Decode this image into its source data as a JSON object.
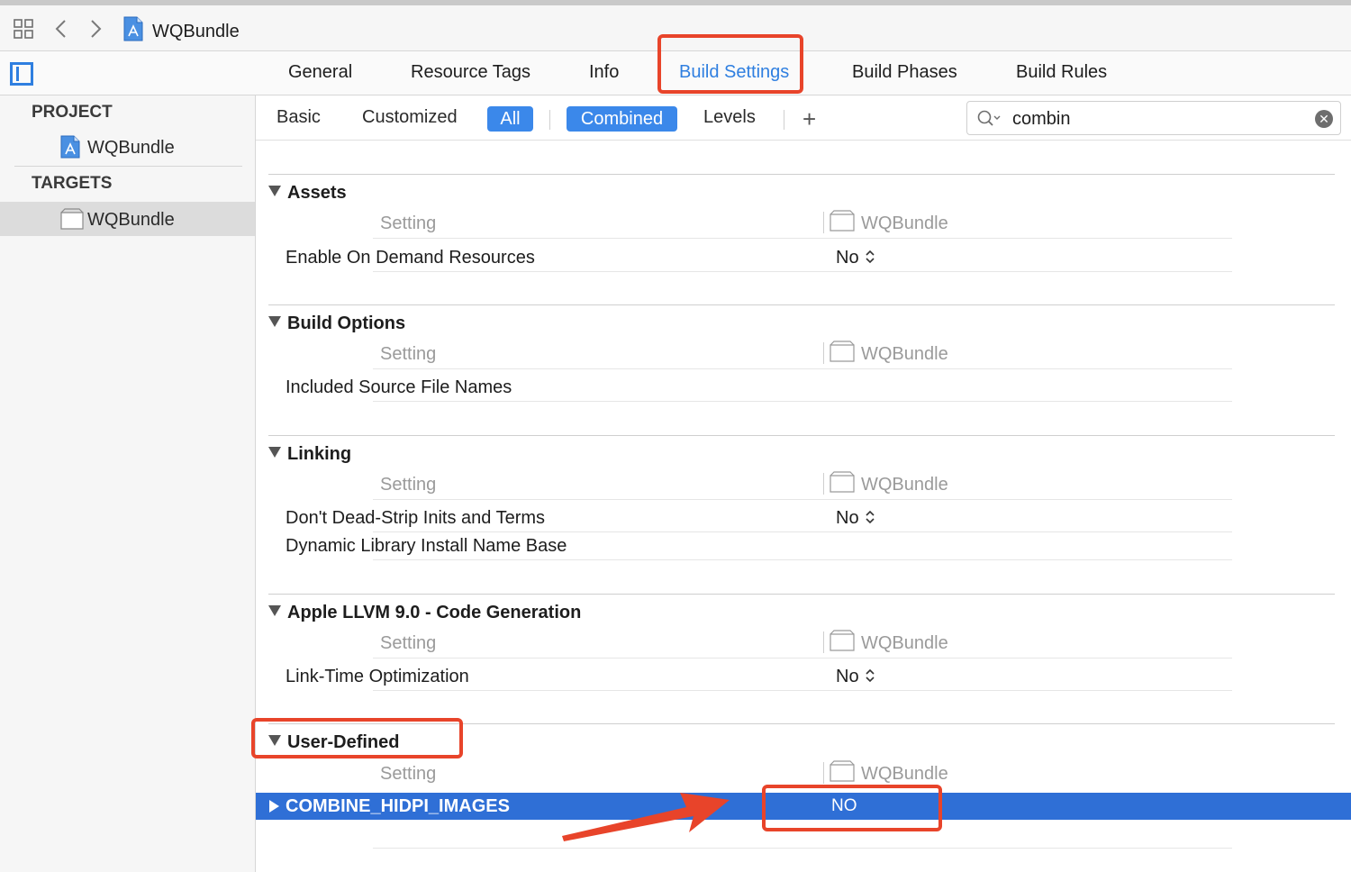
{
  "breadcrumb": {
    "title": "WQBundle"
  },
  "tabs": [
    {
      "label": "General",
      "active": false
    },
    {
      "label": "Resource Tags",
      "active": false
    },
    {
      "label": "Info",
      "active": false
    },
    {
      "label": "Build Settings",
      "active": true
    },
    {
      "label": "Build Phases",
      "active": false
    },
    {
      "label": "Build Rules",
      "active": false
    }
  ],
  "sidebar": {
    "project_heading": "PROJECT",
    "project_item": "WQBundle",
    "targets_heading": "TARGETS",
    "target_item": "WQBundle"
  },
  "filter": {
    "basic": "Basic",
    "customized": "Customized",
    "all": "All",
    "combined": "Combined",
    "levels": "Levels",
    "plus": "+"
  },
  "search": {
    "value": "combin"
  },
  "columns": {
    "setting": "Setting",
    "target": "WQBundle"
  },
  "sections": [
    {
      "title": "Assets",
      "rows": [
        {
          "name": "Enable On Demand Resources",
          "value": "No"
        }
      ]
    },
    {
      "title": "Build Options",
      "rows": [
        {
          "name": "Included Source File Names",
          "value": ""
        }
      ]
    },
    {
      "title": "Linking",
      "rows": [
        {
          "name": "Don't Dead-Strip Inits and Terms",
          "value": "No"
        },
        {
          "name": "Dynamic Library Install Name Base",
          "value": ""
        }
      ]
    },
    {
      "title": "Apple LLVM 9.0 - Code Generation",
      "rows": [
        {
          "name": "Link-Time Optimization",
          "value": "No"
        }
      ]
    },
    {
      "title": "User-Defined",
      "rows": [
        {
          "name": "COMBINE_HIDPI_IMAGES",
          "value": "NO"
        }
      ]
    }
  ],
  "colors": {
    "accent": "#2f7fe0",
    "selection": "#2f6fd6",
    "annotation": "#e8442a"
  }
}
